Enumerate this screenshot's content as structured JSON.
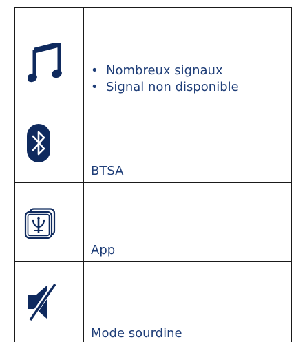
{
  "colors": {
    "text": "#1f3e78",
    "icon": "#0f2a5e",
    "rule": "#1a1a1a"
  },
  "rows": [
    {
      "icon": "music-note-icon",
      "bullets": [
        "Nombreux signaux",
        "Signal non disponible"
      ]
    },
    {
      "icon": "bluetooth-icon",
      "label": "BTSA"
    },
    {
      "icon": "maserati-app-icon",
      "label": "App"
    },
    {
      "icon": "speaker-mute-icon",
      "label": "Mode sourdine"
    }
  ]
}
